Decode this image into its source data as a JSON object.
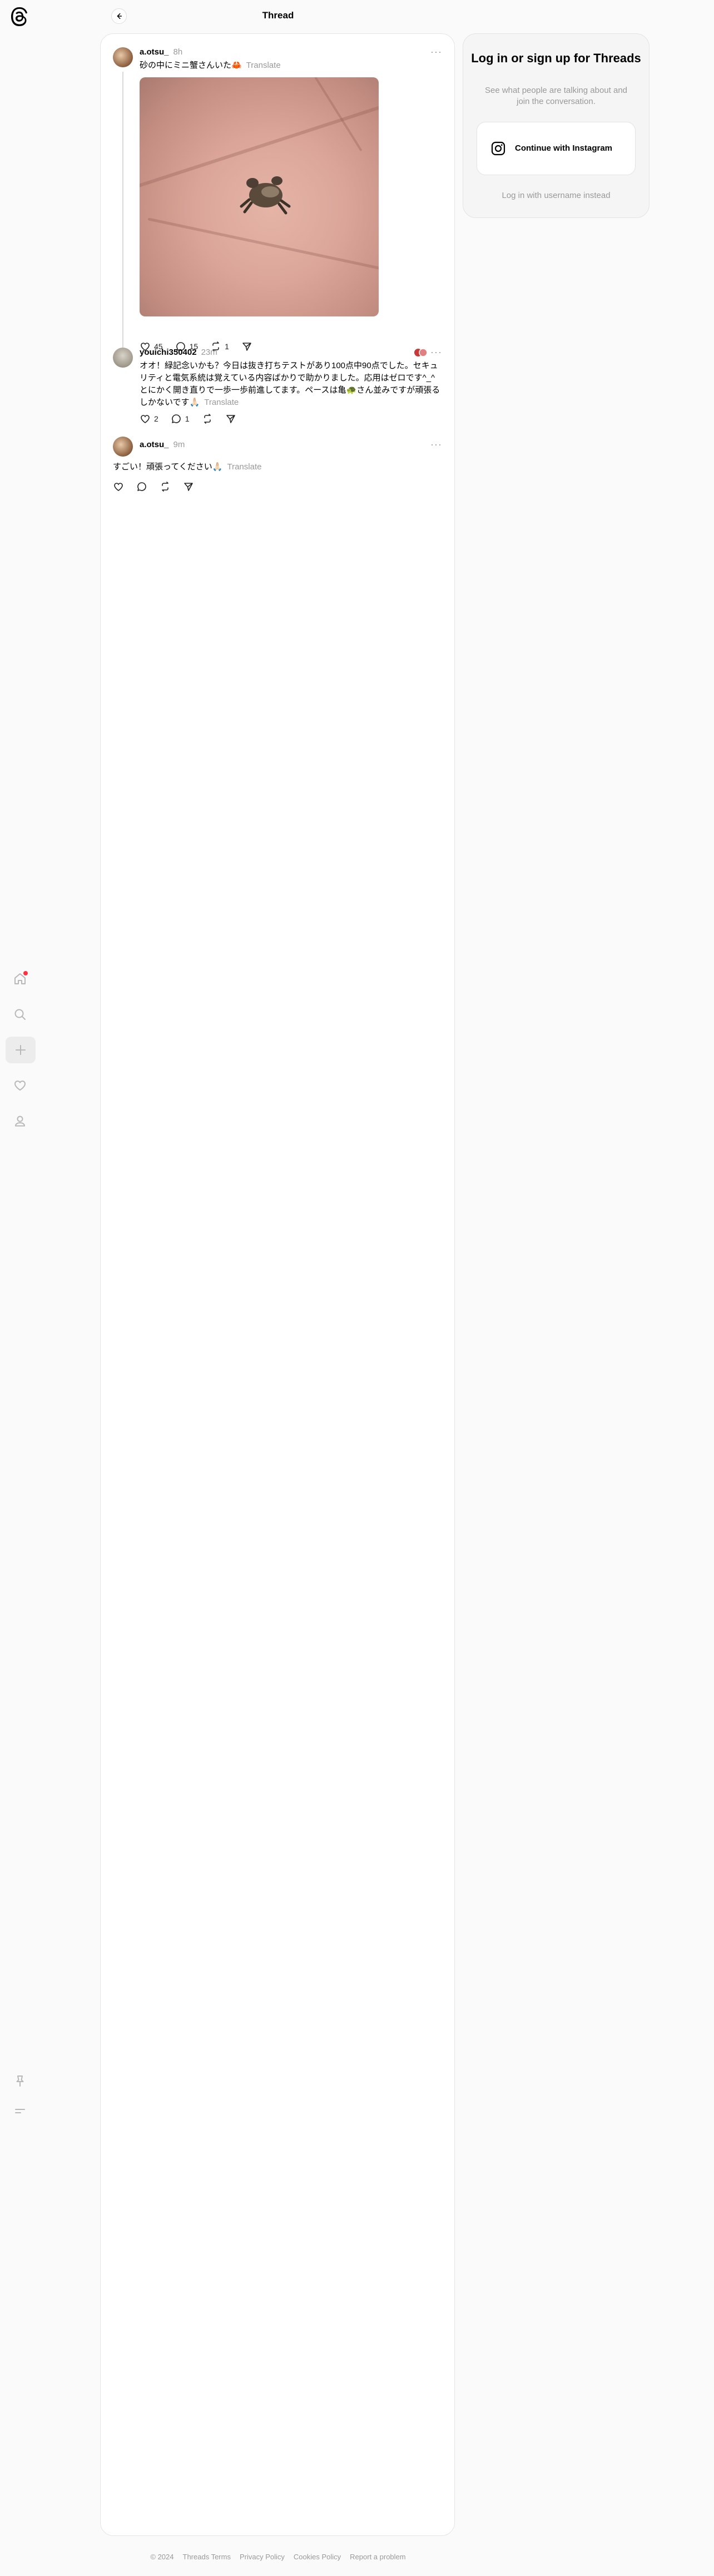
{
  "header": {
    "title": "Thread"
  },
  "nav": {
    "logo": "threads-logo",
    "items": [
      "home-icon",
      "search-icon",
      "create-icon",
      "heart-icon",
      "profile-icon"
    ],
    "bottom": [
      "pin-icon",
      "menu-icon"
    ]
  },
  "posts": [
    {
      "username": "a.otsu_",
      "time": "8h",
      "text": "砂の中にミニ蟹さんいた🦀",
      "translate": "Translate",
      "likes": "45",
      "replies": "15",
      "reposts": "1"
    },
    {
      "username": "youichi350402",
      "time": "23m",
      "text": "オオ！緑記念いかも？今日は抜き打ちテストがあり100点中90点でした。セキュリティと電気系統は覚えている内容ばかりで助かりました。応用はゼロです^_^とにかく開き直りで一歩一歩前進してます。ペースは亀🐢さん並みですが頑張るしかないです🙏🏻",
      "translate": "Translate",
      "likes": "2",
      "replies": "1"
    },
    {
      "username": "a.otsu_",
      "time": "9m",
      "text": "すごい！頑張ってください🙏🏻",
      "translate": "Translate"
    }
  ],
  "login": {
    "title": "Log in or sign up for Threads",
    "subtitle": "See what people are talking about and join the conversation.",
    "button": "Continue with Instagram",
    "alt": "Log in with username instead"
  },
  "footer": [
    "© 2024",
    "Threads Terms",
    "Privacy Policy",
    "Cookies Policy",
    "Report a problem"
  ]
}
